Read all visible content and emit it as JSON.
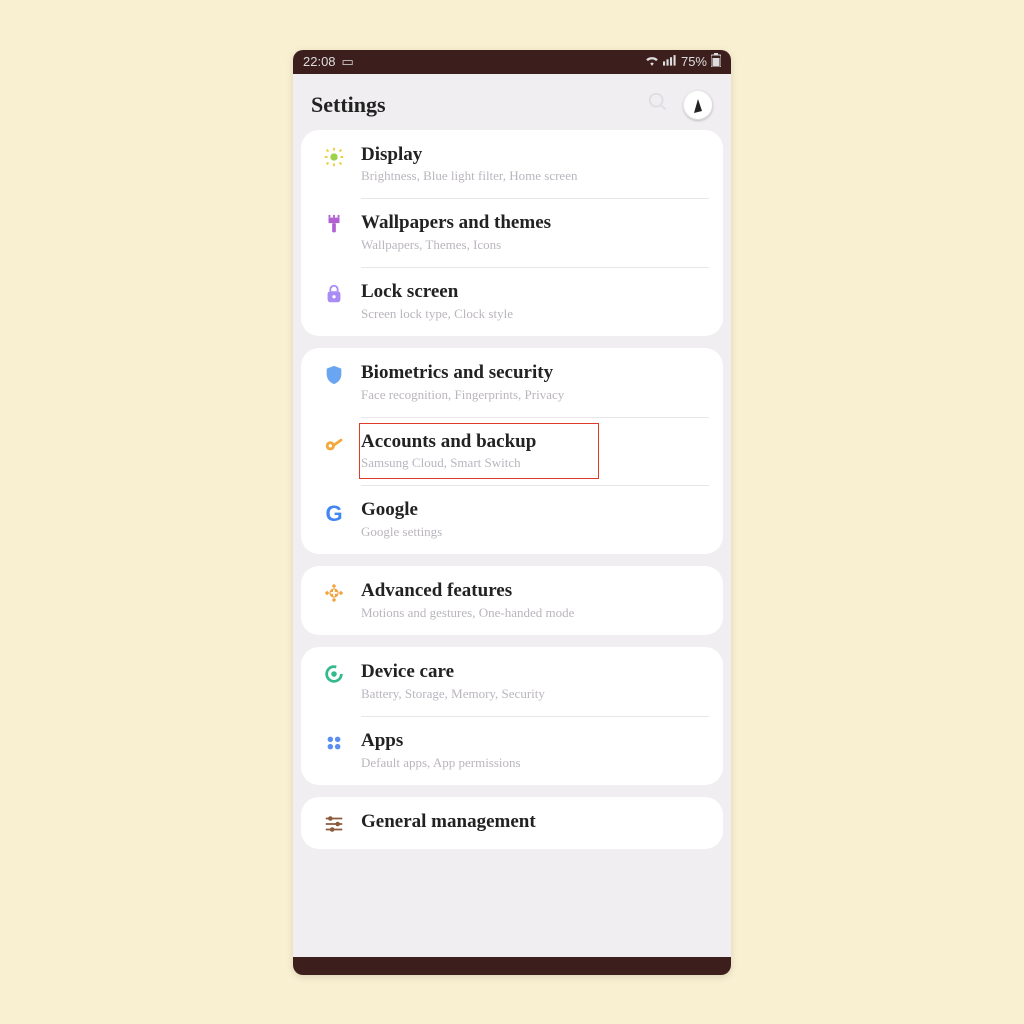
{
  "status": {
    "time": "22:08",
    "battery": "75%"
  },
  "header": {
    "title": "Settings"
  },
  "groups": [
    {
      "rows": [
        {
          "icon": "sun",
          "title": "Display",
          "sub": "Brightness, Blue light filter, Home screen"
        },
        {
          "icon": "brush",
          "title": "Wallpapers and themes",
          "sub": "Wallpapers, Themes, Icons"
        },
        {
          "icon": "lock",
          "title": "Lock screen",
          "sub": "Screen lock type, Clock style"
        }
      ]
    },
    {
      "rows": [
        {
          "icon": "shield",
          "title": "Biometrics and security",
          "sub": "Face recognition, Fingerprints, Privacy"
        },
        {
          "icon": "key",
          "title": "Accounts and backup",
          "sub": "Samsung Cloud, Smart Switch",
          "highlight": true
        },
        {
          "icon": "google",
          "title": "Google",
          "sub": "Google settings"
        }
      ]
    },
    {
      "rows": [
        {
          "icon": "plus",
          "title": "Advanced features",
          "sub": "Motions and gestures, One-handed mode"
        }
      ]
    },
    {
      "rows": [
        {
          "icon": "circle",
          "title": "Device care",
          "sub": "Battery, Storage, Memory, Security"
        },
        {
          "icon": "dots",
          "title": "Apps",
          "sub": "Default apps, App permissions"
        }
      ]
    },
    {
      "rows": [
        {
          "icon": "sliders",
          "title": "General management",
          "sub": ""
        }
      ]
    }
  ]
}
